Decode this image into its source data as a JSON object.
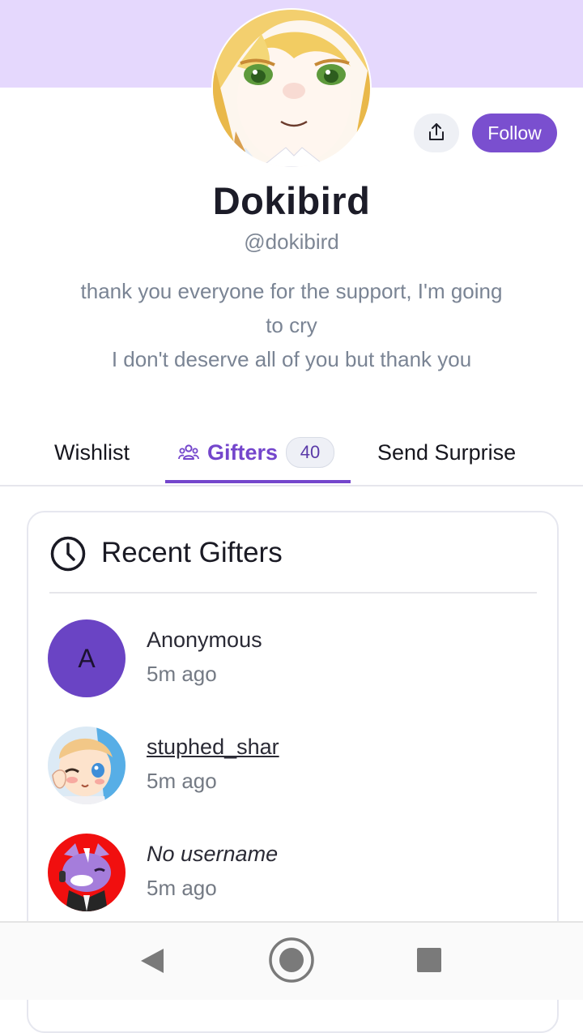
{
  "profile": {
    "display_name": "Dokibird",
    "handle": "@dokibird",
    "bio_line1": "thank you everyone for the support, I'm going",
    "bio_line2": "to cry",
    "bio_line3": "I don't deserve all of you but thank you"
  },
  "actions": {
    "follow_label": "Follow",
    "share_icon": "share-icon"
  },
  "tabs": [
    {
      "label": "Wishlist"
    },
    {
      "label": "Gifters",
      "count": "40",
      "icon": "users-icon"
    },
    {
      "label": "Send Surprise"
    }
  ],
  "recent_gifters": {
    "title": "Recent Gifters",
    "icon": "clock-icon",
    "items": [
      {
        "name": "Anonymous",
        "time": "5m ago",
        "avatar_letter": "A"
      },
      {
        "name": "stuphed_shar",
        "time": "5m ago"
      },
      {
        "name": "No username",
        "time": "5m ago"
      }
    ]
  },
  "colors": {
    "accent": "#7446cc",
    "banner": "#e5d8fd"
  },
  "navbar": {
    "back_icon": "back-triangle-icon",
    "home_icon": "home-circle-icon",
    "recents_icon": "recents-square-icon"
  }
}
